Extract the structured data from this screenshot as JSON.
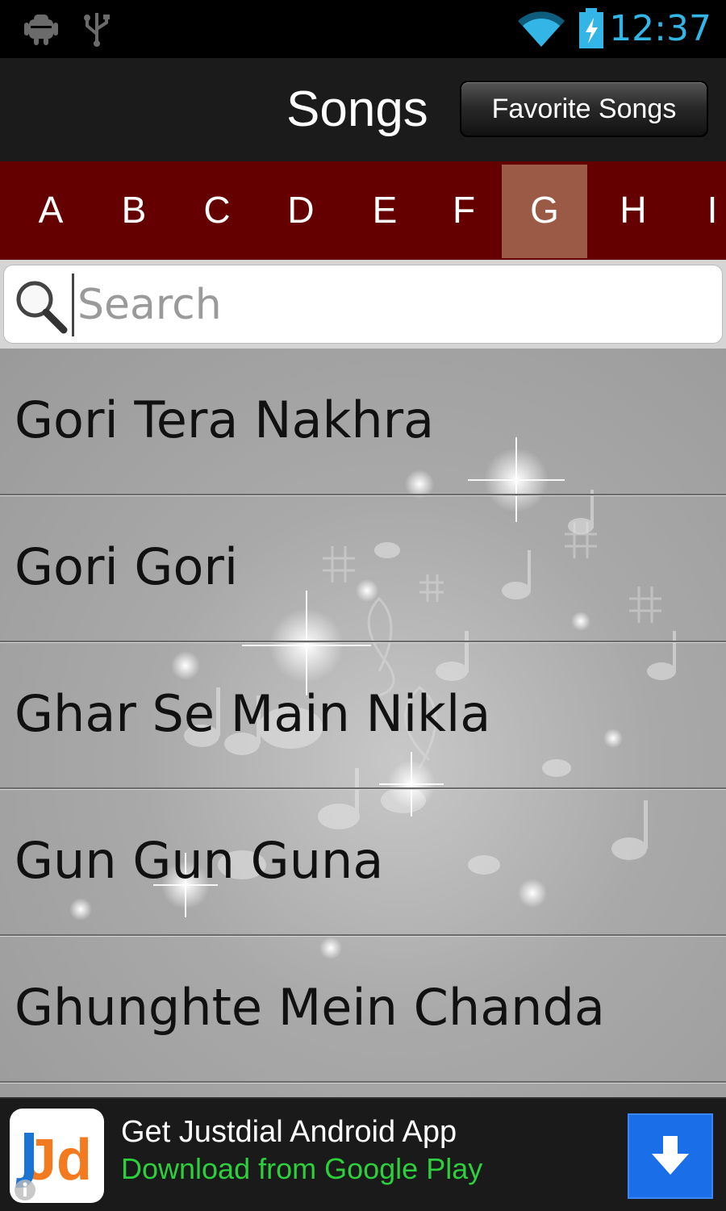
{
  "status_bar": {
    "time": "12:37",
    "icons": [
      "android-debug-icon",
      "usb-icon",
      "wifi-icon",
      "battery-charging-icon"
    ],
    "accent_color": "#33b5e5"
  },
  "header": {
    "title": "Songs",
    "favorite_button_label": "Favorite Songs"
  },
  "alphabet": {
    "letters": [
      "A",
      "B",
      "C",
      "D",
      "E",
      "F",
      "G",
      "H",
      "I"
    ],
    "selected": "G",
    "bar_color": "#650000",
    "selected_color": "#9b5a45"
  },
  "search": {
    "placeholder": "Search",
    "value": ""
  },
  "songs": [
    {
      "title": "Gori Tera Nakhra"
    },
    {
      "title": "Gori Gori"
    },
    {
      "title": "Ghar Se Main Nikla"
    },
    {
      "title": "Gun Gun Guna"
    },
    {
      "title": "Ghunghte Mein Chanda"
    }
  ],
  "ad": {
    "logo_text": "Jd",
    "title": "Get Justdial Android App",
    "subtitle": "Download from Google Play",
    "subtitle_color": "#2dcf3c",
    "button_color": "#1a6ee8"
  }
}
